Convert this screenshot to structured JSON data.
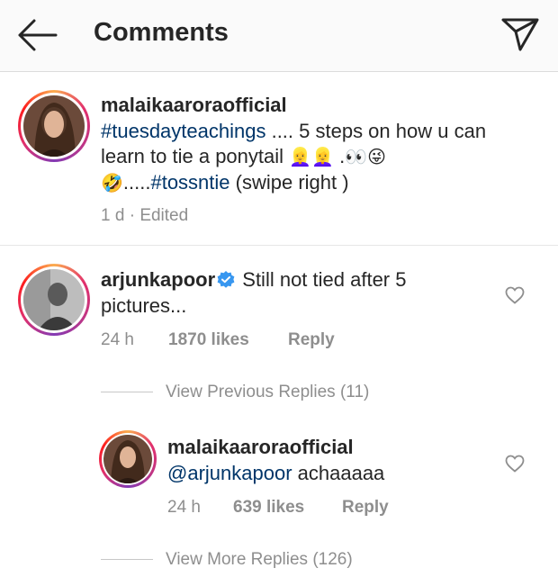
{
  "header": {
    "title": "Comments",
    "back_icon": "arrow-left-icon",
    "send_icon": "paper-plane-icon"
  },
  "caption": {
    "username": "malaikaaroraofficial",
    "hashtag1": "#tuesdayteachings",
    "text1": " .... 5 steps on how u can learn to tie a ponytail ",
    "emoji_a": "👱‍♀️",
    "emoji_b": "👱‍♀️",
    "text2": " .",
    "emoji_c": "👀",
    "emoji_d": "😜",
    "emoji_e": "🤣",
    "text3": ".....",
    "hashtag2": "#tossntie",
    "text4": " (swipe right )",
    "time": "1 d",
    "separator": "·",
    "edited": "Edited"
  },
  "comment": {
    "username": "arjunkapoor",
    "text": "Still not tied after 5 pictures...",
    "time": "24 h",
    "likes": "1870 likes",
    "reply": "Reply"
  },
  "view_previous": "View Previous Replies (11)",
  "reply_comment": {
    "username": "malaikaaroraofficial",
    "mention": "@arjunkapoor",
    "text": " achaaaaa",
    "time": "24 h",
    "likes": "639 likes",
    "reply": "Reply"
  },
  "view_more": "View More Replies (126)",
  "colors": {
    "hashtag": "#003569",
    "muted": "#8e8e8e",
    "verified": "#3897f0"
  }
}
